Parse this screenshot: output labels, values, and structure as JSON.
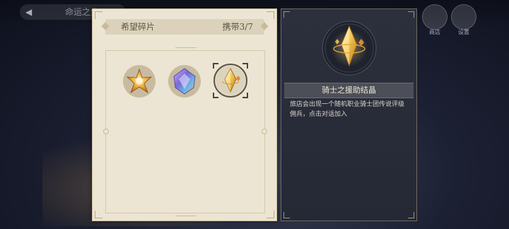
{
  "top_bar": {
    "back_label": "命运之尘",
    "icons": [
      {
        "name": "cart-icon",
        "label": "商店"
      },
      {
        "name": "settings-icon",
        "label": "设置"
      }
    ]
  },
  "fragments_panel": {
    "title": "希望碎片",
    "carry_count": "携带3/7",
    "items": [
      {
        "name": "star-fragment",
        "color": "#e0a63a",
        "selected": false
      },
      {
        "name": "prism-fragment",
        "color": "#8b7bd8",
        "selected": false
      },
      {
        "name": "knight-aid-crystal",
        "color": "#f1c34a",
        "selected": true
      }
    ]
  },
  "detail_panel": {
    "item_name": "骑士之援助结晶",
    "description": "旅店会出现一个随机职业骑士团传说评级佣兵，点击对话加入",
    "accent_color": "#f2c44c"
  }
}
